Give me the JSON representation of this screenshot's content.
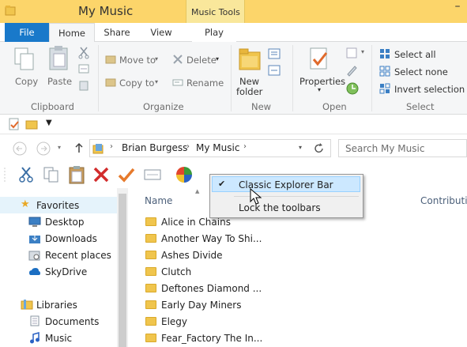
{
  "window": {
    "title": "My Music",
    "context_tab": "Music Tools",
    "minimize_glyph": "–"
  },
  "tabs": [
    {
      "label": "File"
    },
    {
      "label": "Home"
    },
    {
      "label": "Share"
    },
    {
      "label": "View"
    },
    {
      "label": "Play"
    }
  ],
  "ribbon": {
    "clipboard": {
      "copy": "Copy",
      "paste": "Paste",
      "group": "Clipboard"
    },
    "organize": {
      "move_to": "Move to",
      "copy_to": "Copy to",
      "delete": "Delete",
      "rename": "Rename",
      "group": "Organize"
    },
    "new": {
      "new_folder_line1": "New",
      "new_folder_line2": "folder",
      "group": "New"
    },
    "open": {
      "properties": "Properties",
      "group": "Open"
    },
    "select": {
      "select_all": "Select all",
      "select_none": "Select none",
      "invert": "Invert selection",
      "group": "Select"
    }
  },
  "address": {
    "crumbs": [
      "Brian Burgess",
      "My Music"
    ],
    "sep": "›",
    "search_placeholder": "Search My Music"
  },
  "columns": {
    "name": "Name",
    "contributing": "Contributin"
  },
  "context_menu": {
    "item1": "Classic Explorer Bar",
    "item2": "Lock the toolbars",
    "check": "✔"
  },
  "nav": {
    "favorites": "Favorites",
    "desktop": "Desktop",
    "downloads": "Downloads",
    "recent": "Recent places",
    "skydrive": "SkyDrive",
    "libraries": "Libraries",
    "documents": "Documents",
    "music": "Music"
  },
  "files": [
    "Alice in Chains",
    "Another Way To Shi...",
    "Ashes Divide",
    "Clutch",
    "Deftones Diamond ...",
    "Early Day Miners",
    "Elegy",
    "Fear_Factory The In..."
  ]
}
